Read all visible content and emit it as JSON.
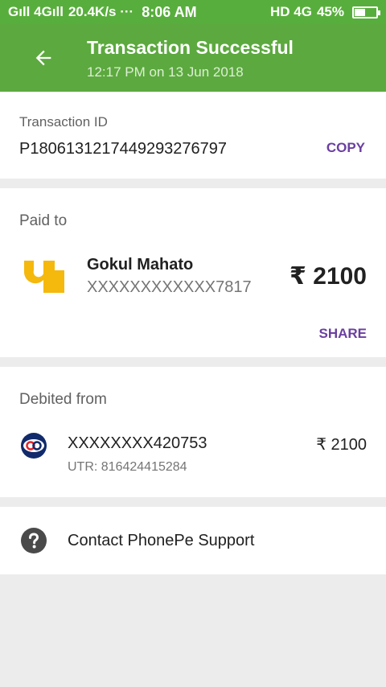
{
  "status_bar": {
    "signal": "Gıll 4Gıll",
    "speed": "20.4K/s ···",
    "time": "8:06 AM",
    "right": "HD 4G",
    "battery": "45%"
  },
  "header": {
    "title": "Transaction Successful",
    "subtitle": "12:17 PM on 13 Jun 2018",
    "back_icon": "arrow-left-icon",
    "color": "#5ca93f"
  },
  "transaction": {
    "label": "Transaction ID",
    "id": "P1806131217449293276797",
    "copy_label": "COPY"
  },
  "paid_to": {
    "label": "Paid to",
    "name": "Gokul Mahato",
    "account": "XXXXXXXXXXXX7817",
    "amount": "₹ 2100",
    "share_label": "SHARE",
    "logo_color": "#f5b80d"
  },
  "debited_from": {
    "label": "Debited from",
    "account": "XXXXXXXX420753",
    "utr": "UTR: 816424415284",
    "amount": "₹ 2100"
  },
  "support": {
    "label": "Contact PhonePe Support",
    "icon": "help-icon"
  },
  "colors": {
    "accent": "#6b3fa0",
    "header": "#5ca93f"
  }
}
